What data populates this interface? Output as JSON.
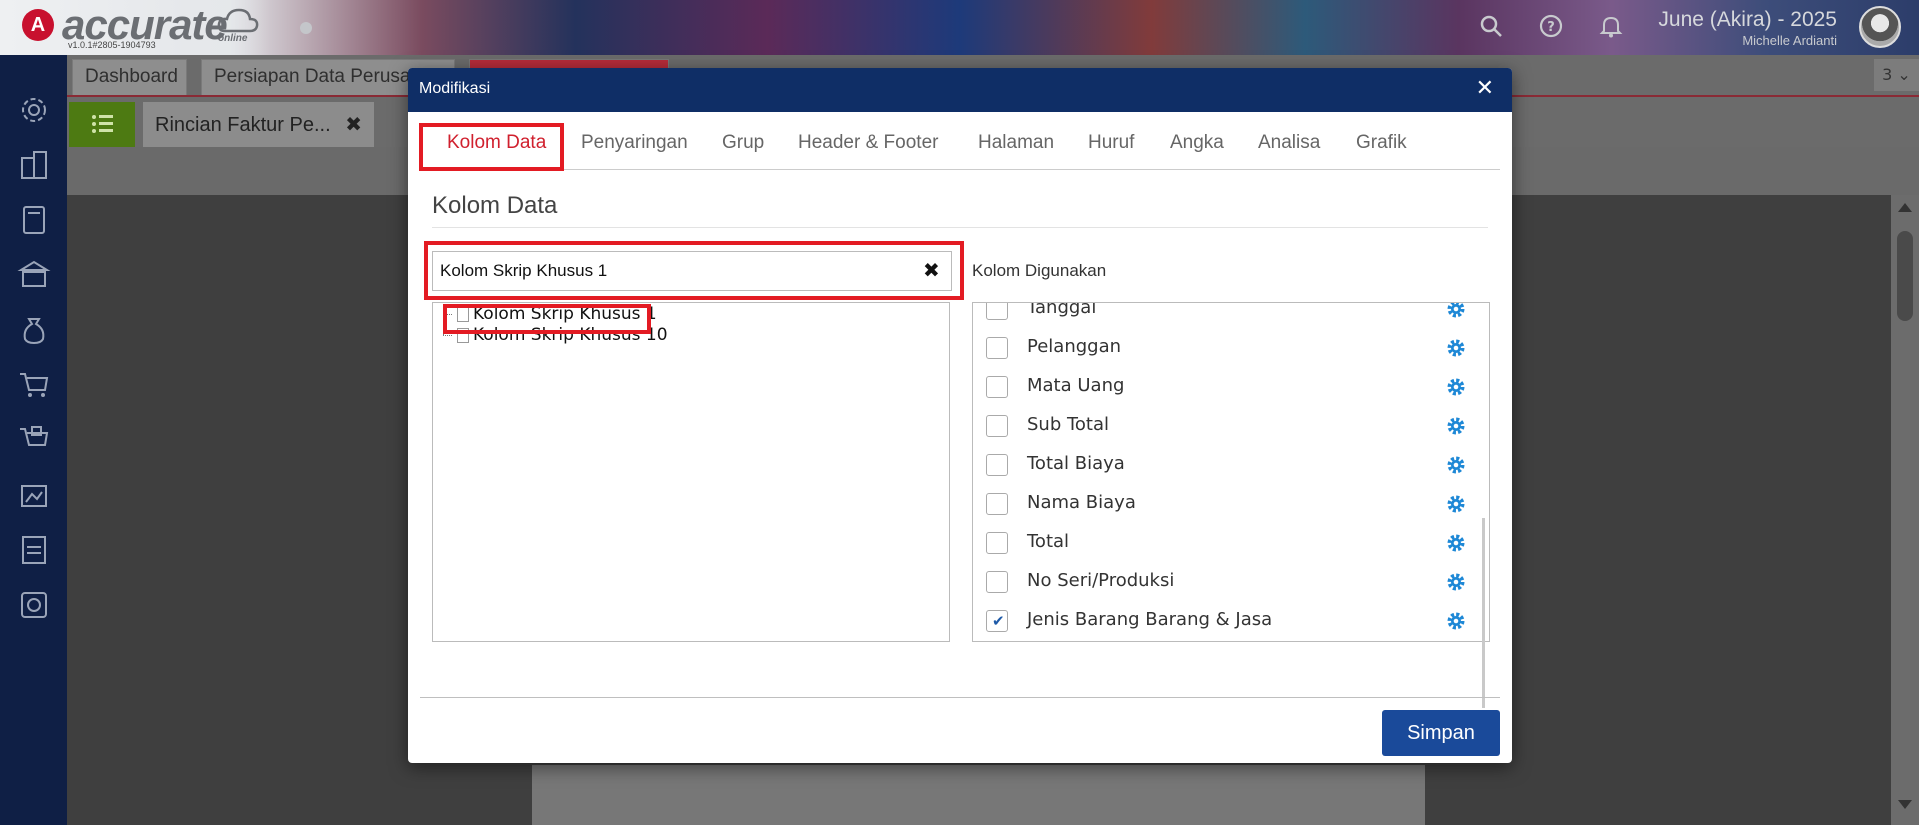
{
  "app": {
    "logo_text": "accurate",
    "logo_sub": "online",
    "version": "v1.0.1#2805-1904793",
    "user_name": "June (Akira) - 2025",
    "user_sub": "Michelle Ardianti"
  },
  "tabs_row1": [
    {
      "label": "Dashboard"
    },
    {
      "label": "Persiapan Data Perusahaan"
    },
    {
      "label": ""
    }
  ],
  "rows_select": "3 ⌄",
  "doc_tab": {
    "label": "Rincian Faktur Pe...",
    "close": "✖"
  },
  "modal": {
    "title": "Modifikasi",
    "close": "✕",
    "tabs": [
      {
        "label": "Kolom Data"
      },
      {
        "label": "Penyaringan"
      },
      {
        "label": "Grup"
      },
      {
        "label": "Header & Footer"
      },
      {
        "label": "Halaman"
      },
      {
        "label": "Huruf"
      },
      {
        "label": "Angka"
      },
      {
        "label": "Analisa"
      },
      {
        "label": "Grafik"
      }
    ],
    "section_title": "Kolom Data",
    "search_value": "Kolom Skrip Khusus 1",
    "search_clear": "✖",
    "tree": [
      {
        "label": "Kolom Skrip Khusus 1"
      },
      {
        "label": "Kolom Skrip Khusus 10"
      }
    ],
    "used_label": "Kolom Digunakan",
    "used": [
      {
        "label": "Tanggal",
        "checked": false
      },
      {
        "label": "Pelanggan",
        "checked": false
      },
      {
        "label": "Mata Uang",
        "checked": false
      },
      {
        "label": "Sub Total",
        "checked": false
      },
      {
        "label": "Total Biaya",
        "checked": false
      },
      {
        "label": "Nama Biaya",
        "checked": false
      },
      {
        "label": "Total",
        "checked": false
      },
      {
        "label": "No Seri/Produksi",
        "checked": false
      },
      {
        "label": "Jenis Barang Barang & Jasa",
        "checked": true
      }
    ],
    "save_label": "Simpan"
  },
  "colors": {
    "modal_header": "#0f2e66",
    "accent_red": "#e31b23",
    "save_button": "#1a4a9a",
    "sidebar": "#0f1f45",
    "gear": "#1e88d6"
  }
}
